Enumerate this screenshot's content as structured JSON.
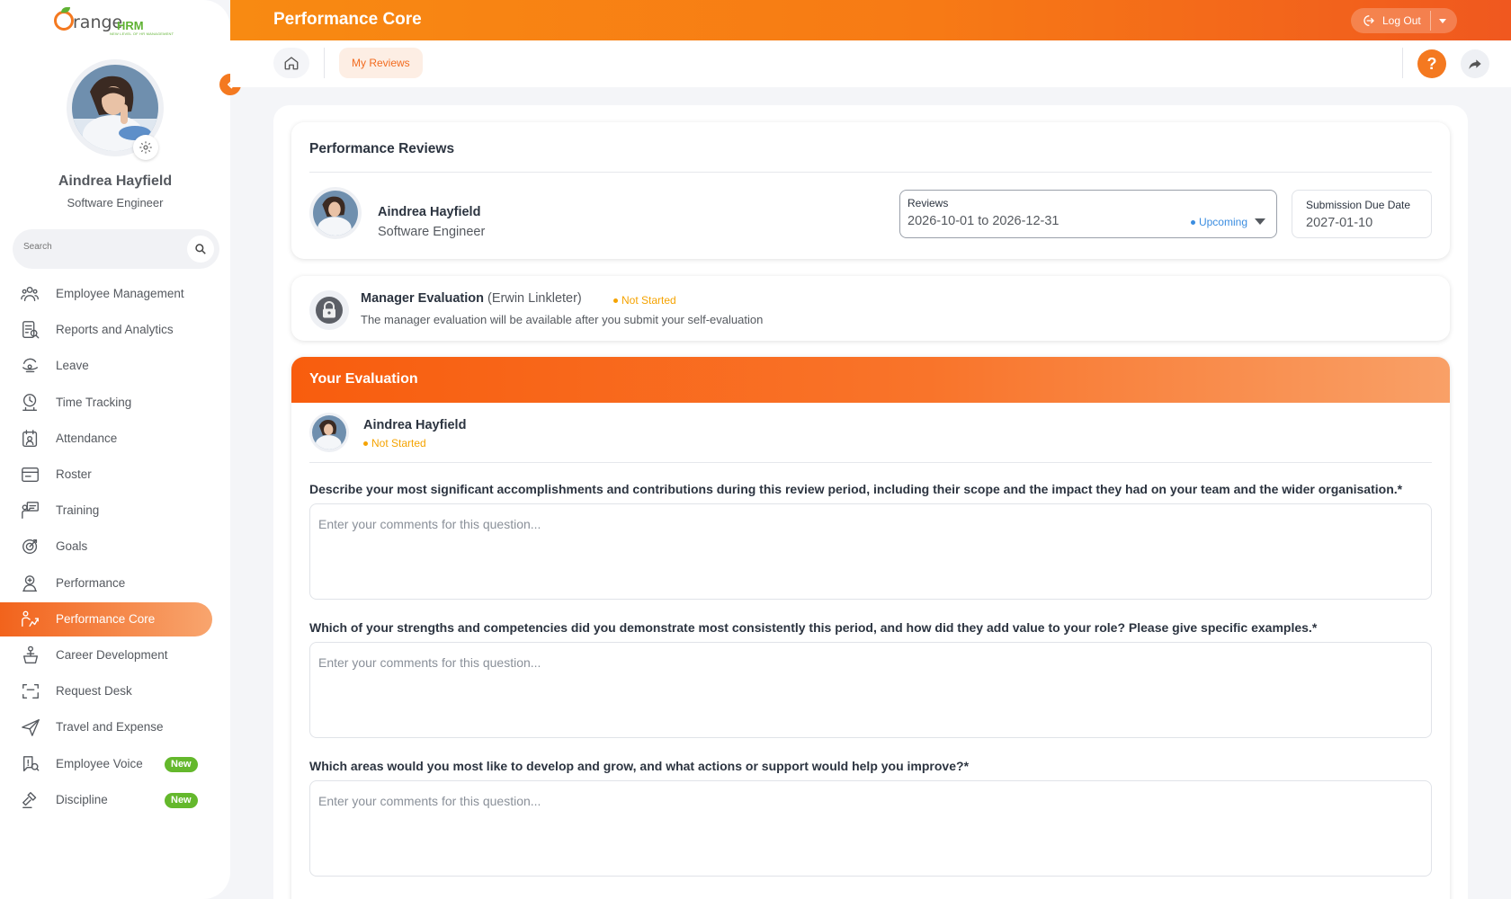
{
  "header": {
    "title": "Performance Core",
    "logout_label": "Log Out"
  },
  "subnav": {
    "home_icon": "home-icon",
    "tab_label": "My Reviews",
    "help_label": "?"
  },
  "sidebar": {
    "logo_word": "range",
    "logo_hrm": "HRM",
    "logo_tagline": "NEW LEVEL OF HR MANAGEMENT",
    "user_name": "Aindrea Hayfield",
    "user_role": "Software Engineer",
    "search_placeholder": "Search",
    "items": [
      {
        "label": "Employee Management",
        "icon": "people-group-icon"
      },
      {
        "label": "Reports and Analytics",
        "icon": "report-icon"
      },
      {
        "label": "Leave",
        "icon": "leave-icon"
      },
      {
        "label": "Time Tracking",
        "icon": "clock-icon"
      },
      {
        "label": "Attendance",
        "icon": "calendar-user-icon"
      },
      {
        "label": "Roster",
        "icon": "roster-icon"
      },
      {
        "label": "Training",
        "icon": "training-icon"
      },
      {
        "label": "Goals",
        "icon": "target-icon"
      },
      {
        "label": "Performance",
        "icon": "award-icon"
      },
      {
        "label": "Performance Core",
        "icon": "performance-core-icon",
        "active": true
      },
      {
        "label": "Career Development",
        "icon": "career-icon"
      },
      {
        "label": "Request Desk",
        "icon": "request-icon"
      },
      {
        "label": "Travel and Expense",
        "icon": "plane-icon"
      },
      {
        "label": "Employee Voice",
        "icon": "voice-icon",
        "badge": "New"
      },
      {
        "label": "Discipline",
        "icon": "gavel-icon",
        "badge": "New"
      }
    ]
  },
  "reviews_card": {
    "title": "Performance Reviews",
    "employee_name": "Aindrea Hayfield",
    "employee_role": "Software Engineer",
    "reviews_label": "Reviews",
    "reviews_value": "2026-10-01 to 2026-12-31",
    "reviews_status": "Upcoming",
    "due_label": "Submission Due Date",
    "due_value": "2027-01-10"
  },
  "manager_card": {
    "title": "Manager Evaluation",
    "manager_name": "(Erwin Linkleter)",
    "status": "Not Started",
    "description": "The manager evaluation will be available after you submit your self-evaluation"
  },
  "evaluation": {
    "title": "Your Evaluation",
    "employee_name": "Aindrea Hayfield",
    "status": "Not Started",
    "placeholder": "Enter your comments for this question...",
    "questions": [
      "Describe your most significant accomplishments and contributions during this review period, including their scope and the impact they had on your team and the wider organisation.",
      "Which of your strengths and competencies did you demonstrate most consistently this period, and how did they add value to your role? Please give specific examples.",
      "Which areas would you most like to develop and grow, and what actions or support would help you improve?"
    ],
    "required_mark": "*"
  },
  "colors": {
    "brand_orange": "#f47920",
    "active_gradient_start": "#f2631c",
    "badge_green": "#64b82c",
    "status_yellow": "#f5a300",
    "status_blue": "#3b8de0"
  }
}
